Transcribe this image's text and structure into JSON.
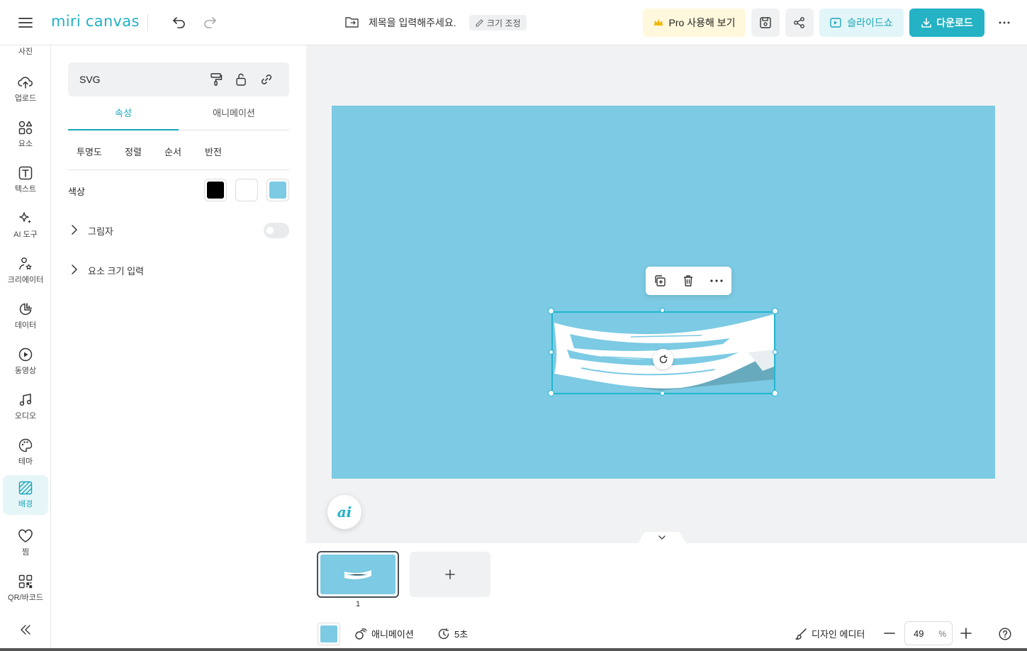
{
  "app": {
    "logo_text": "miri canvas",
    "brand_color": "#21b2c6"
  },
  "header": {
    "doc_title": "제목을 입력해주세요.",
    "resize_label": "크기 조정",
    "pro_label": "Pro 사용해 보기",
    "slideshow_label": "슬라이드쇼",
    "download_label": "다운로드"
  },
  "sidebar": {
    "top_partial_label": "사진",
    "items": [
      {
        "label": "업로드",
        "icon": "upload-cloud-icon"
      },
      {
        "label": "요소",
        "icon": "elements-icon"
      },
      {
        "label": "텍스트",
        "icon": "text-icon"
      },
      {
        "label": "AI 도구",
        "icon": "sparkle-icon"
      },
      {
        "label": "크리에이터",
        "icon": "creator-icon"
      },
      {
        "label": "데이터",
        "icon": "chart-icon"
      },
      {
        "label": "동영상",
        "icon": "play-icon"
      },
      {
        "label": "오디오",
        "icon": "music-icon"
      },
      {
        "label": "테마",
        "icon": "palette-icon"
      },
      {
        "label": "배경",
        "icon": "background-icon"
      },
      {
        "label": "찜",
        "icon": "heart-icon"
      },
      {
        "label": "QR/바코드",
        "icon": "qr-icon"
      }
    ],
    "active_item": "배경"
  },
  "panel": {
    "element_type": "SVG",
    "tabs": [
      "속성",
      "애니메이션"
    ],
    "active_tab": "속성",
    "subtabs": [
      "투명도",
      "정렬",
      "순서",
      "반전"
    ],
    "color_label": "색상",
    "colors": [
      "#000000",
      "#ffffff",
      "#7ccae3"
    ],
    "shadow_label": "그림자",
    "shadow_enabled": false,
    "size_input_label": "요소 크기 입력"
  },
  "canvas": {
    "background_color": "#7ccae3"
  },
  "pages": {
    "current_page_number": "1"
  },
  "bottom": {
    "animation_label": "애니메이션",
    "duration_label": "5초",
    "design_editor_label": "디자인 에디터",
    "zoom_value": "49",
    "zoom_unit": "%"
  },
  "ai_button_label": "ai"
}
